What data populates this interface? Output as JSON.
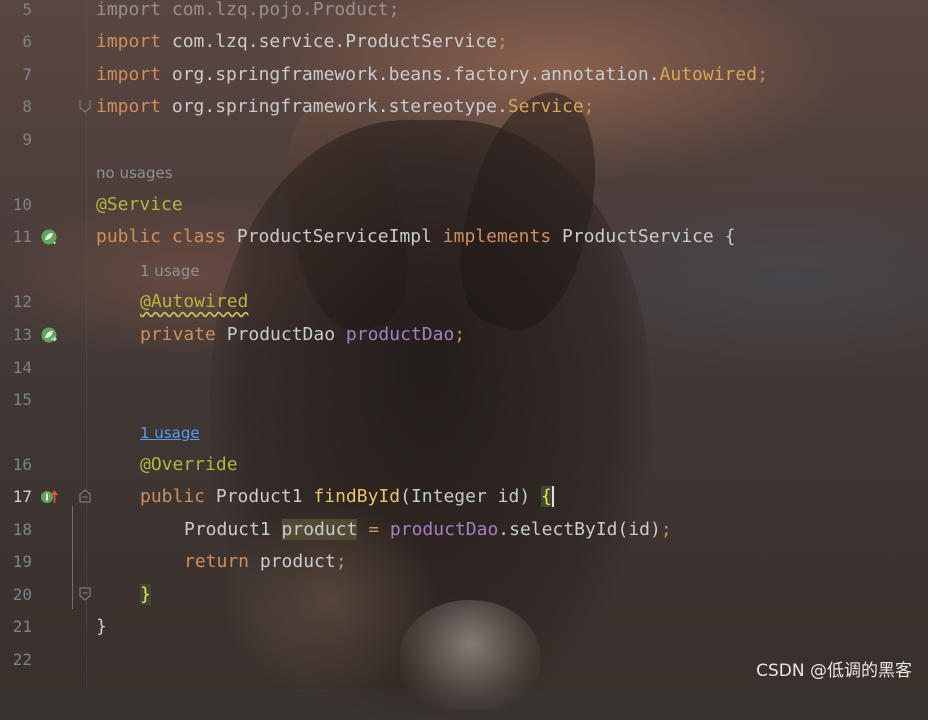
{
  "editor": {
    "line_numbers": {
      "n5": "5",
      "n6": "6",
      "n7": "7",
      "n8": "8",
      "n9": "9",
      "n10": "10",
      "n11": "11",
      "n12": "12",
      "n13": "13",
      "n14": "14",
      "n15": "15",
      "n16": "16",
      "n17": "17",
      "n18": "18",
      "n19": "19",
      "n20": "20",
      "n21": "21",
      "n22": "22"
    },
    "hints": {
      "no_usages": "no usages",
      "one_usage": "1 usage",
      "one_usage_link": "1 usage"
    },
    "lines": {
      "l5": "import com.lzq.pojo.Product;",
      "l6": {
        "kw": "import",
        "path": " com.lzq.service.ProductService",
        "semi": ";"
      },
      "l7": {
        "kw": "import",
        "path": " org.springframework.beans.factory.annotation.",
        "cls": "Autowired",
        "semi": ";"
      },
      "l8": {
        "kw": "import",
        "path": " org.springframework.stereotype.",
        "cls": "Service",
        "semi": ";"
      },
      "l10": {
        "ann": "@Service"
      },
      "l11": {
        "kw1": "public class",
        "name": " ProductServiceImpl ",
        "kw2": "implements",
        "iface": " ProductService {"
      },
      "l12": {
        "ann": "@Autowired"
      },
      "l13": {
        "kw": "private",
        "type": " ProductDao ",
        "field": "productDao",
        "semi": ";"
      },
      "l16": {
        "ann": "@Override"
      },
      "l17": {
        "kw": "public",
        "type": " Product1 ",
        "fn": "findById",
        "params": "(Integer id) ",
        "brace": "{"
      },
      "l18": {
        "type": "Product1 ",
        "var": "product",
        "eq": " = ",
        "field": "productDao",
        "call": ".selectById(id)",
        "semi": ";"
      },
      "l19": {
        "kw": "return",
        "rest": " product",
        "semi": ";"
      },
      "l20": {
        "brace": "}"
      },
      "l21": {
        "brace": "}"
      }
    }
  },
  "icons": {
    "line11": "spring-bean-icon",
    "line13": "spring-autowire-icon",
    "line17": "override-method-icon"
  },
  "colors": {
    "keyword": "#cf8e5d",
    "annotation": "#b8b342",
    "field": "#a87fc2",
    "function": "#e8c46a",
    "link": "#5a9af0",
    "spring_green": "#5fa85a"
  },
  "watermark": "CSDN @低调的黑客"
}
